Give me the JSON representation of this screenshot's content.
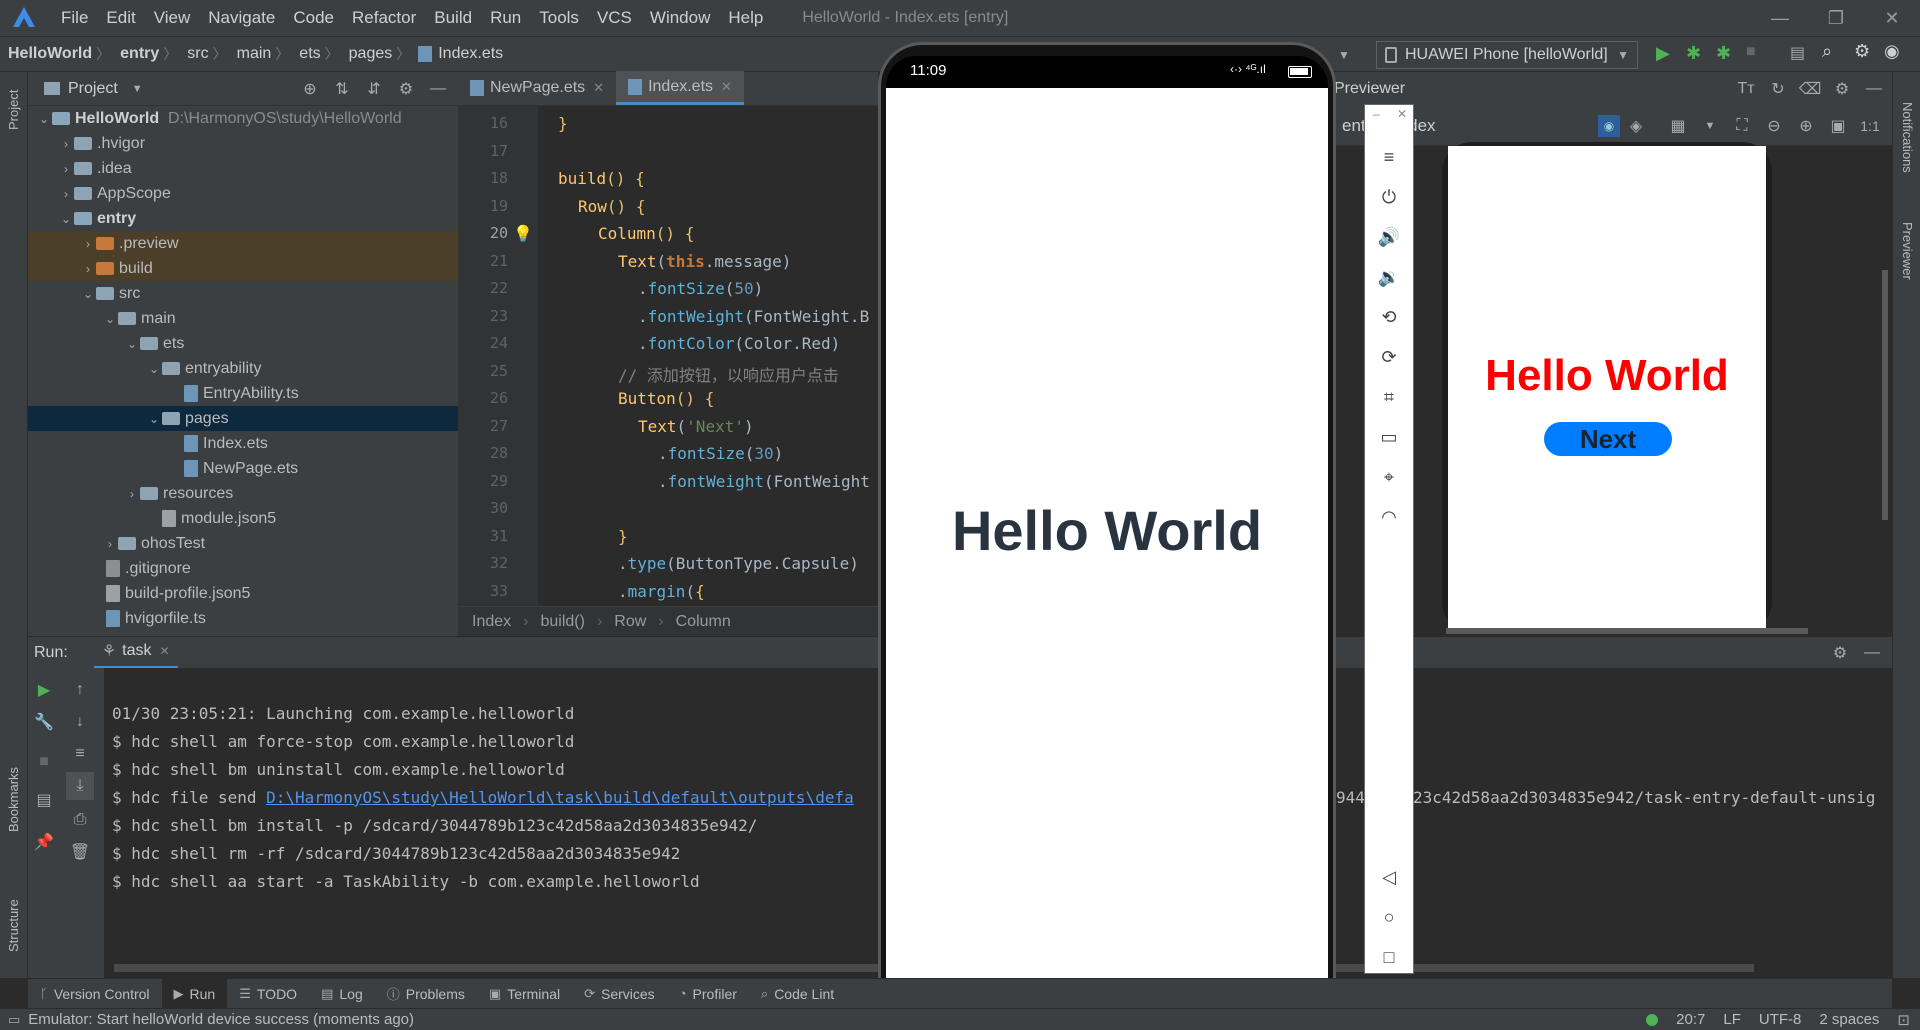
{
  "menu": {
    "items": [
      "File",
      "Edit",
      "View",
      "Navigate",
      "Code",
      "Refactor",
      "Build",
      "Run",
      "Tools",
      "VCS",
      "Window",
      "Help"
    ],
    "window_title": "HelloWorld - Index.ets [entry]"
  },
  "nav": {
    "crumbs": [
      "HelloWorld",
      "entry",
      "src",
      "main",
      "ets",
      "pages",
      "Index.ets"
    ],
    "device": "HUAWEI Phone [helloWorld]"
  },
  "project": {
    "title": "Project",
    "tree": [
      {
        "label": "HelloWorld",
        "path": "D:\\HarmonyOS\\study\\HelloWorld"
      },
      {
        "label": ".hvigor"
      },
      {
        "label": ".idea"
      },
      {
        "label": "AppScope"
      },
      {
        "label": "entry"
      },
      {
        "label": ".preview"
      },
      {
        "label": "build"
      },
      {
        "label": "src"
      },
      {
        "label": "main"
      },
      {
        "label": "ets"
      },
      {
        "label": "entryability"
      },
      {
        "label": "EntryAbility.ts"
      },
      {
        "label": "pages"
      },
      {
        "label": "Index.ets"
      },
      {
        "label": "NewPage.ets"
      },
      {
        "label": "resources"
      },
      {
        "label": "module.json5"
      },
      {
        "label": "ohosTest"
      },
      {
        "label": ".gitignore"
      },
      {
        "label": "build-profile.json5"
      },
      {
        "label": "hvigorfile.ts"
      }
    ]
  },
  "editor": {
    "tabs": [
      "NewPage.ets",
      "Index.ets"
    ],
    "line_numbers": [
      "16",
      "17",
      "18",
      "19",
      "20",
      "21",
      "22",
      "23",
      "24",
      "25",
      "26",
      "27",
      "28",
      "29",
      "30",
      "31",
      "32",
      "33"
    ],
    "breadcrumb": [
      "Index",
      "build()",
      "Row",
      "Column"
    ]
  },
  "previewer": {
    "title": "Previewer",
    "page": "entry : Index",
    "hello_text": "Hello World",
    "button_text": "Next",
    "accent_color": "#ff0000",
    "button_color": "#007dff"
  },
  "phone": {
    "time": "11:09",
    "hello_text": "Hello World"
  },
  "run": {
    "label": "Run:",
    "tab": "task",
    "lines": [
      "01/30 23:05:21: Launching com.example.helloworld",
      "$ hdc shell am force-stop com.example.helloworld",
      "$ hdc shell bm uninstall com.example.helloworld",
      "$ hdc file send ",
      "$ hdc shell bm install -p /sdcard/3044789b123c42d58aa2d3034835e942/",
      "$ hdc shell rm -rf /sdcard/3044789b123c42d58aa2d3034835e942",
      "$ hdc shell aa start -a TaskAbility -b com.example.helloworld"
    ],
    "link_text": "D:\\HarmonyOS\\study\\HelloWorld\\task\\build\\default\\outputs\\defa",
    "link_tail": "944",
    "link_tail2": "23c42d58aa2d3034835e942/task-entry-default-unsig"
  },
  "tools": [
    "Version Control",
    "Run",
    "TODO",
    "Log",
    "Problems",
    "Terminal",
    "Services",
    "Profiler",
    "Code Lint"
  ],
  "status": {
    "message": "Emulator: Start helloWorld device success (moments ago)",
    "position": "20:7",
    "line_ending": "LF",
    "encoding": "UTF-8",
    "indent": "2 spaces"
  },
  "side": {
    "left": [
      "Project",
      "Bookmarks",
      "Structure"
    ],
    "right": [
      "Notifications",
      "Previewer"
    ]
  }
}
